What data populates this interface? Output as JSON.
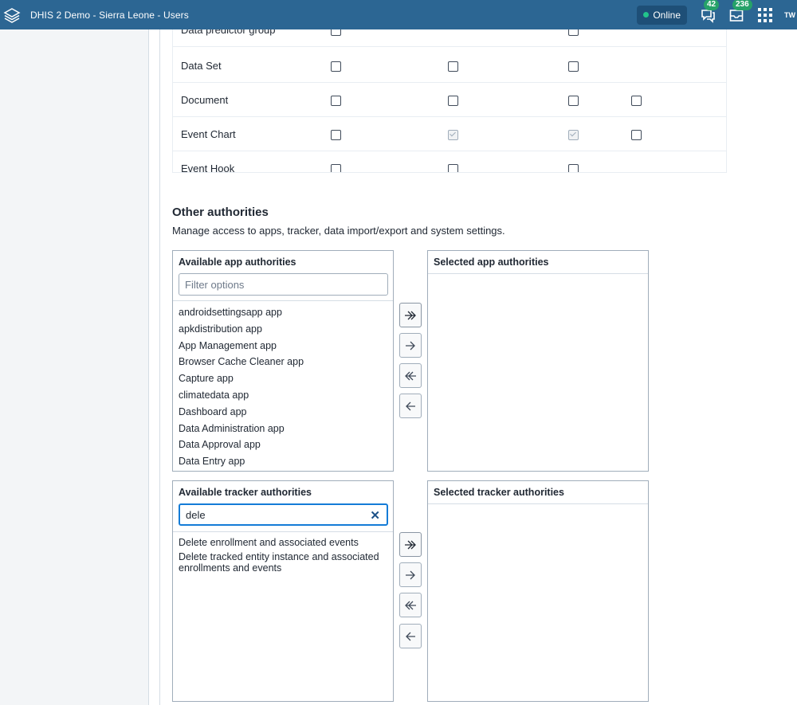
{
  "header": {
    "title": "DHIS 2 Demo - Sierra Leone - Users",
    "online_label": "Online",
    "messages_count": "42",
    "interpretations_count": "236",
    "profile_initials": "TW"
  },
  "metadata_rows": [
    {
      "name": "Data predictor group"
    },
    {
      "name": "Data Set"
    },
    {
      "name": "Document"
    },
    {
      "name": "Event Chart"
    },
    {
      "name": "Event Hook"
    }
  ],
  "other_authorities": {
    "title": "Other authorities",
    "description": "Manage access to apps, tracker, data import/export and system settings.",
    "app": {
      "available_title": "Available app authorities",
      "selected_title": "Selected app authorities",
      "filter_placeholder": "Filter options",
      "options": [
        "androidsettingsapp app",
        "apkdistribution app",
        "App Management app",
        "Browser Cache Cleaner app",
        "Capture app",
        "climatedata app",
        "Dashboard app",
        "Data Administration app",
        "Data Approval app",
        "Data Entry app"
      ]
    },
    "tracker": {
      "available_title": "Available tracker authorities",
      "selected_title": "Selected tracker authorities",
      "filter_value": "dele",
      "options": [
        "Delete enrollment and associated events",
        "Delete tracked entity instance and associated enrollments and events"
      ]
    }
  },
  "colors": {
    "header_bg": "#2c6693",
    "online_dot": "#22c48b",
    "badge_bg": "#26a269",
    "focus_border": "#147cd7"
  }
}
